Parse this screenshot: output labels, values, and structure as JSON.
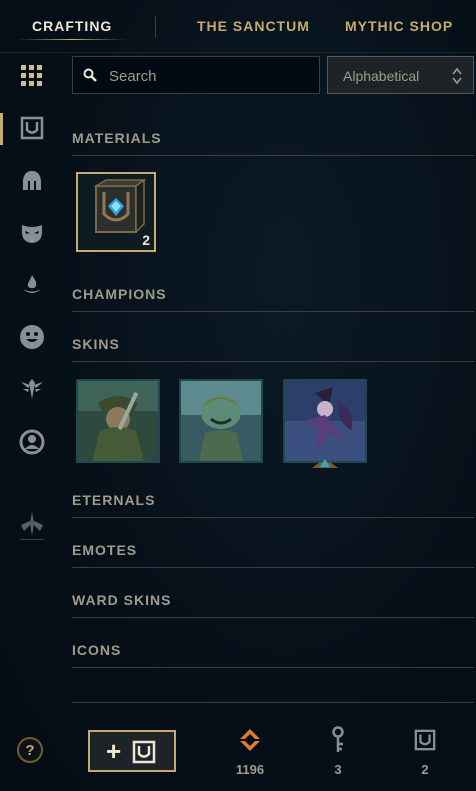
{
  "nav": {
    "tabs": [
      {
        "label": "CRAFTING",
        "active": true
      },
      {
        "label": "THE SANCTUM",
        "active": false
      },
      {
        "label": "MYTHIC SHOP",
        "active": false
      }
    ]
  },
  "sidebar": {
    "items": [
      {
        "icon": "grid-icon",
        "active": true
      },
      {
        "icon": "chest-icon",
        "active": false
      },
      {
        "icon": "helmet-icon",
        "active": false
      },
      {
        "icon": "mask-icon",
        "active": false
      },
      {
        "icon": "flame-icon",
        "active": false
      },
      {
        "icon": "emote-face-icon",
        "active": false
      },
      {
        "icon": "ward-icon",
        "active": false
      },
      {
        "icon": "profile-icon",
        "active": false
      },
      {
        "icon": "eternals-icon",
        "active": false
      }
    ]
  },
  "search": {
    "placeholder": "Search",
    "value": ""
  },
  "sort": {
    "selected": "Alphabetical"
  },
  "sections": {
    "materials": "MATERIALS",
    "champions": "CHAMPIONS",
    "skins": "SKINS",
    "eternals": "ETERNALS",
    "emotes": "EMOTES",
    "ward_skins": "WARD SKINS",
    "icons": "ICONS"
  },
  "materials": [
    {
      "name": "hextech-chest",
      "count": "2"
    }
  ],
  "skins": [
    {
      "name": "skin-1"
    },
    {
      "name": "skin-2"
    },
    {
      "name": "skin-3"
    }
  ],
  "footer": {
    "help_label": "?",
    "add_label": "+",
    "currencies": [
      {
        "icon": "orange-essence-icon",
        "value": "1196"
      },
      {
        "icon": "key-icon",
        "value": "3"
      },
      {
        "icon": "chest-icon",
        "value": "2"
      }
    ]
  },
  "colors": {
    "gold": "#c8aa6e",
    "text": "#a09b8c",
    "background": "#061019",
    "essence_orange": "#e07a2f",
    "skin_border": "#1e4a4f"
  }
}
